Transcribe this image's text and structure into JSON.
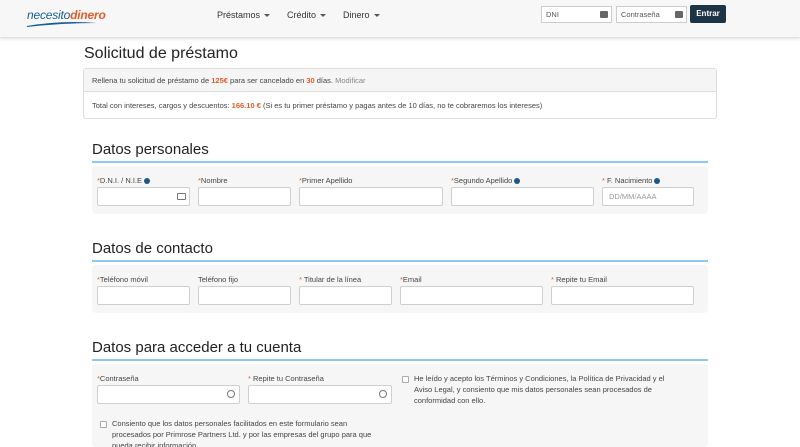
{
  "header": {
    "logo": {
      "part1": "necesito",
      "part2": "dinero"
    },
    "nav": [
      {
        "label": "Préstamos"
      },
      {
        "label": "Crédito"
      },
      {
        "label": "Dinero"
      }
    ],
    "login": {
      "dni_placeholder": "DNI",
      "password_placeholder": "Contraseña",
      "submit_label": "Entrar"
    }
  },
  "page": {
    "title": "Solicitud de préstamo",
    "summary": {
      "line1_prefix": "Rellena tu solicitud de préstamo de ",
      "amount": "125€",
      "line1_mid": " para ser cancelado en ",
      "days": "30",
      "line1_suffix": " días. ",
      "modify_label": "Modificar",
      "line2_prefix": "Total con intereses, cargos y descuentos: ",
      "total": "166.10 €",
      "line2_suffix": " (Si es tu primer préstamo y pagas antes de 10 días, no te cobraremos los intereses)"
    }
  },
  "personal": {
    "title": "Datos personales",
    "dni_label": "D.N.I. / N.I.E",
    "nombre_label": "Nombre",
    "apellido1_label": "Primer Apellido",
    "apellido2_label": "Segundo Apellido",
    "nacimiento_label": "F. Nacimiento",
    "nacimiento_placeholder": "DD/MM/AAAA"
  },
  "contact": {
    "title": "Datos de contacto",
    "movil_label": "Teléfono móvil",
    "fijo_label": "Teléfono fijo",
    "titular_label": "Titular de la línea",
    "email_label": "Email",
    "email_repeat_label": "Repite tu Email"
  },
  "account": {
    "title": "Datos para acceder a tu cuenta",
    "password_label": "Contraseña",
    "password_repeat_label": "Repite tu Contraseña",
    "terms_text_1": "He leído y acepto los ",
    "terms_link": "Términos y Condiciones",
    "terms_text_2": ", la ",
    "privacy_link": "Política de Privacidad",
    "terms_text_3": " y el ",
    "legal_link": "Aviso Legal",
    "terms_text_4": ", y consiento que mis datos personales sean procesados de conformidad con ello.",
    "consent_text": "Consiento que los datos personales facilitados en este formulario sean procesados por Primrose Partners Ltd. y por las empresas del grupo para que pueda recibir información"
  }
}
